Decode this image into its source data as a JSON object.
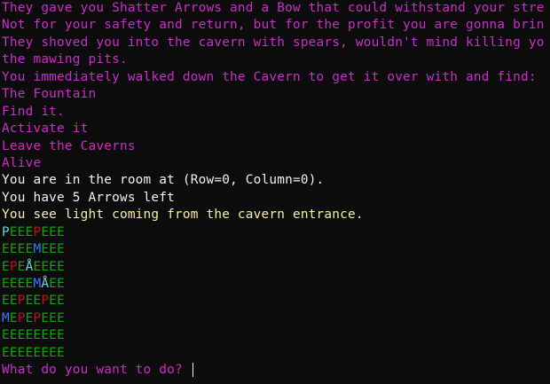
{
  "colors": {
    "background": "#0c0c0c",
    "narrative": "#c82fc8",
    "status": "#f2f2f2",
    "hint": "#f9f1a5",
    "cell_P": "#61d6d6",
    "cell_P_red": "#c50f1f",
    "cell_E": "#13a10e",
    "cell_M": "#3b78ff",
    "cell_A": "#61d6d6"
  },
  "story": [
    "They gave you Shatter Arrows and a Bow that could withstand your stre",
    "Not for your safety and return, but for the profit you are gonna brin",
    "They shoved you into the cavern with spears, wouldn't mind killing yo",
    "the mawing pits.",
    "You immediately walked down the Cavern to get it over with and find:",
    "The Fountain",
    "Find it.",
    "Activate it",
    "Leave the Caverns",
    "Alive"
  ],
  "status": {
    "position": "You are in the room at (Row=0, Column=0).",
    "arrows": "You have 5 Arrows left",
    "hint": "You see light coming from the cavern entrance."
  },
  "map": [
    [
      {
        "ch": "P",
        "c": "cell_P"
      },
      {
        "ch": "E",
        "c": "cell_E"
      },
      {
        "ch": "E",
        "c": "cell_E"
      },
      {
        "ch": "E",
        "c": "cell_E"
      },
      {
        "ch": "P",
        "c": "cell_P_red"
      },
      {
        "ch": "E",
        "c": "cell_E"
      },
      {
        "ch": "E",
        "c": "cell_E"
      },
      {
        "ch": "E",
        "c": "cell_E"
      }
    ],
    [
      {
        "ch": "E",
        "c": "cell_E"
      },
      {
        "ch": "E",
        "c": "cell_E"
      },
      {
        "ch": "E",
        "c": "cell_E"
      },
      {
        "ch": "E",
        "c": "cell_E"
      },
      {
        "ch": "M",
        "c": "cell_M"
      },
      {
        "ch": "E",
        "c": "cell_E"
      },
      {
        "ch": "E",
        "c": "cell_E"
      },
      {
        "ch": "E",
        "c": "cell_E"
      }
    ],
    [
      {
        "ch": "E",
        "c": "cell_E"
      },
      {
        "ch": "P",
        "c": "cell_P_red"
      },
      {
        "ch": "E",
        "c": "cell_E"
      },
      {
        "ch": "Å",
        "c": "cell_A"
      },
      {
        "ch": "E",
        "c": "cell_E"
      },
      {
        "ch": "E",
        "c": "cell_E"
      },
      {
        "ch": "E",
        "c": "cell_E"
      },
      {
        "ch": "E",
        "c": "cell_E"
      }
    ],
    [
      {
        "ch": "E",
        "c": "cell_E"
      },
      {
        "ch": "E",
        "c": "cell_E"
      },
      {
        "ch": "E",
        "c": "cell_E"
      },
      {
        "ch": "E",
        "c": "cell_E"
      },
      {
        "ch": "M",
        "c": "cell_M"
      },
      {
        "ch": "Å",
        "c": "cell_A"
      },
      {
        "ch": "E",
        "c": "cell_E"
      },
      {
        "ch": "E",
        "c": "cell_E"
      }
    ],
    [
      {
        "ch": "E",
        "c": "cell_E"
      },
      {
        "ch": "E",
        "c": "cell_E"
      },
      {
        "ch": "P",
        "c": "cell_P_red"
      },
      {
        "ch": "E",
        "c": "cell_E"
      },
      {
        "ch": "E",
        "c": "cell_E"
      },
      {
        "ch": "P",
        "c": "cell_P_red"
      },
      {
        "ch": "E",
        "c": "cell_E"
      },
      {
        "ch": "E",
        "c": "cell_E"
      }
    ],
    [
      {
        "ch": "M",
        "c": "cell_M"
      },
      {
        "ch": "E",
        "c": "cell_E"
      },
      {
        "ch": "P",
        "c": "cell_P_red"
      },
      {
        "ch": "E",
        "c": "cell_E"
      },
      {
        "ch": "P",
        "c": "cell_P_red"
      },
      {
        "ch": "E",
        "c": "cell_E"
      },
      {
        "ch": "E",
        "c": "cell_E"
      },
      {
        "ch": "E",
        "c": "cell_E"
      }
    ],
    [
      {
        "ch": "E",
        "c": "cell_E"
      },
      {
        "ch": "E",
        "c": "cell_E"
      },
      {
        "ch": "E",
        "c": "cell_E"
      },
      {
        "ch": "E",
        "c": "cell_E"
      },
      {
        "ch": "E",
        "c": "cell_E"
      },
      {
        "ch": "E",
        "c": "cell_E"
      },
      {
        "ch": "E",
        "c": "cell_E"
      },
      {
        "ch": "E",
        "c": "cell_E"
      }
    ],
    [
      {
        "ch": "E",
        "c": "cell_E"
      },
      {
        "ch": "E",
        "c": "cell_E"
      },
      {
        "ch": "E",
        "c": "cell_E"
      },
      {
        "ch": "E",
        "c": "cell_E"
      },
      {
        "ch": "E",
        "c": "cell_E"
      },
      {
        "ch": "E",
        "c": "cell_E"
      },
      {
        "ch": "E",
        "c": "cell_E"
      },
      {
        "ch": "E",
        "c": "cell_E"
      }
    ]
  ],
  "prompt": {
    "text": "What do you want to do? ",
    "input_value": ""
  }
}
